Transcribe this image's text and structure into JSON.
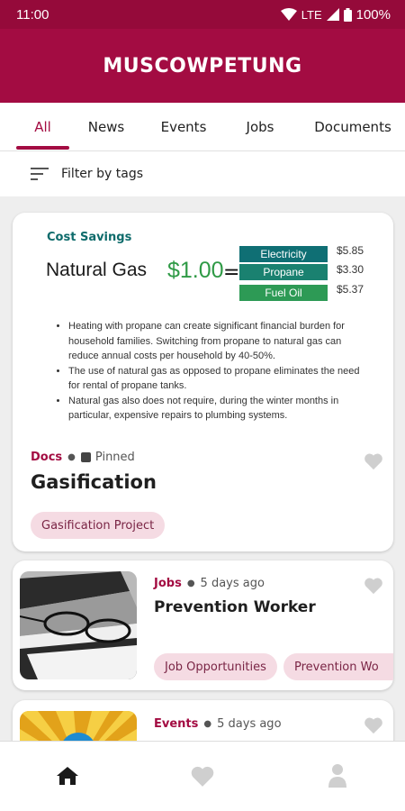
{
  "status_bar": {
    "time": "11:00",
    "network": "LTE",
    "battery": "100%"
  },
  "app": {
    "title": "MUSCOWPETUNG",
    "brand_color": "#a30c42",
    "accent_color": "#a30c42"
  },
  "tabs": [
    {
      "label": "All",
      "active": true
    },
    {
      "label": "News",
      "active": false
    },
    {
      "label": "Events",
      "active": false
    },
    {
      "label": "Jobs",
      "active": false
    },
    {
      "label": "Documents",
      "active": false
    }
  ],
  "filter": {
    "label": "Filter by tags",
    "icon": "filter-icon"
  },
  "cards": [
    {
      "image": {
        "heading": "Cost Savings",
        "fuel": "Natural Gas",
        "price": "$1.00",
        "equals": "=",
        "comparisons": [
          {
            "label": "Electricity",
            "price": "$5.85",
            "color": "#0f6f74"
          },
          {
            "label": "Propane",
            "price": "$3.30",
            "color": "#1a8170"
          },
          {
            "label": "Fuel Oil",
            "price": "$5.37",
            "color": "#2d9a55"
          }
        ],
        "bullets": [
          "Heating with propane can create significant financial burden for household families. Switching from propane to natural gas can reduce annual costs per household by 40-50%.",
          "The use of natural gas as opposed to propane eliminates the need for rental of propane tanks.",
          "Natural gas also does not require, during the winter months in particular, expensive repairs to plumbing systems."
        ]
      },
      "category": "Docs",
      "meta": "Pinned",
      "title": "Gasification",
      "tags": [
        "Gasification Project"
      ]
    },
    {
      "category": "Jobs",
      "meta": "5 days ago",
      "title": "Prevention Worker",
      "tags": [
        "Job Opportunities",
        "Prevention Wo"
      ]
    },
    {
      "category": "Events",
      "meta": "5 days ago"
    }
  ],
  "bottom_nav": [
    {
      "icon": "home-icon",
      "active": true
    },
    {
      "icon": "heart-icon",
      "active": false
    },
    {
      "icon": "profile-icon",
      "active": false
    }
  ]
}
